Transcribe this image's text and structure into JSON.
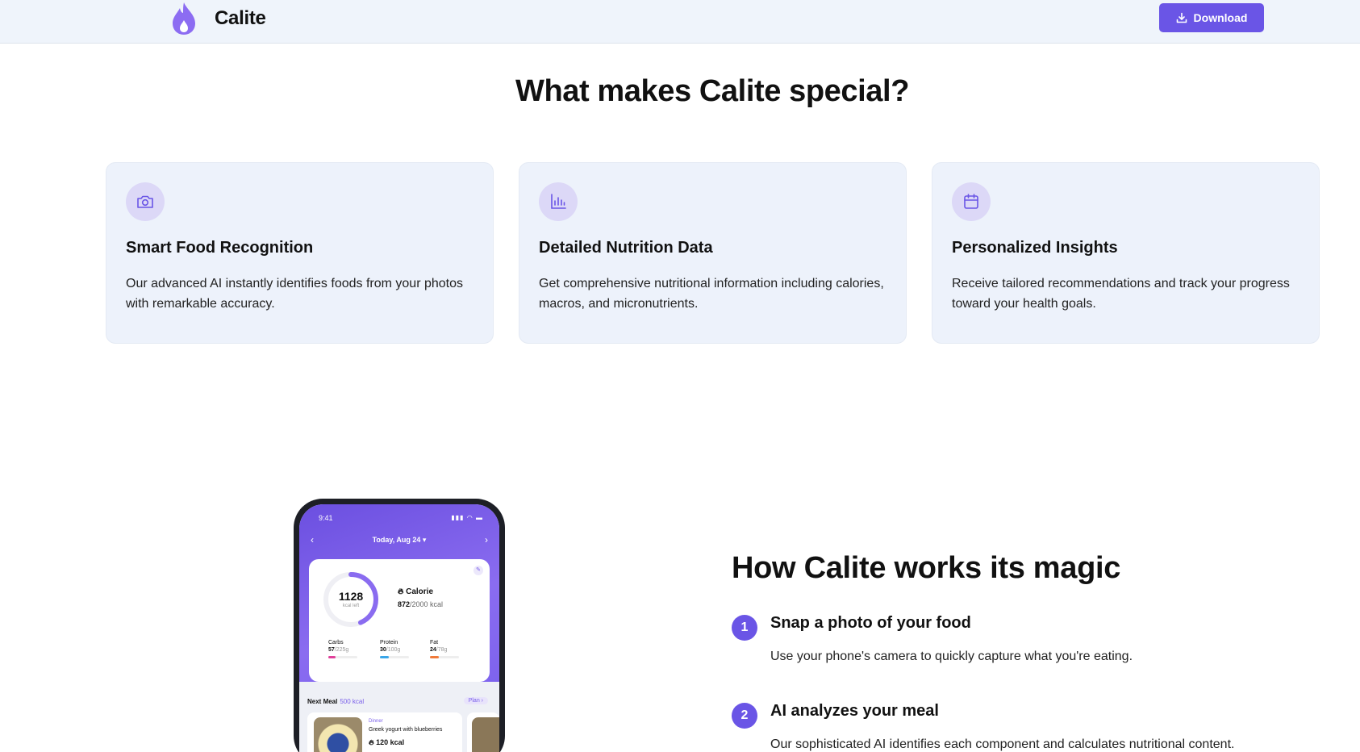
{
  "header": {
    "brand": "Calite",
    "download_label": "Download"
  },
  "features": {
    "heading": "What makes Calite special?",
    "cards": [
      {
        "icon": "camera-icon",
        "title": "Smart Food Recognition",
        "desc": "Our advanced AI instantly identifies foods from your photos with remarkable accuracy."
      },
      {
        "icon": "bar-chart-icon",
        "title": "Detailed Nutrition Data",
        "desc": "Get comprehensive nutritional information including calories, macros, and micronutrients."
      },
      {
        "icon": "calendar-icon",
        "title": "Personalized Insights",
        "desc": "Receive tailored recommendations and track your progress toward your health goals."
      }
    ]
  },
  "phone": {
    "time": "9:41",
    "date": "Today, Aug 24 ▾",
    "kcal_left": "1128",
    "kcal_left_label": "kcal left",
    "calorie_title": "Calorie",
    "calorie_eaten": "872",
    "calorie_goal": "/2000 kcal",
    "calorie_progress": 0.436,
    "macros": [
      {
        "name": "Carbs",
        "value": "57",
        "goal": "/225g",
        "color": "#e0409a",
        "progress": 0.25
      },
      {
        "name": "Protein",
        "value": "30",
        "goal": "/100g",
        "color": "#3aa6e8",
        "progress": 0.3
      },
      {
        "name": "Fat",
        "value": "24",
        "goal": "/78g",
        "color": "#f07a3a",
        "progress": 0.31
      }
    ],
    "next_meal_label": "Next Meal",
    "next_meal_kcal": "500 kcal",
    "plan_label": "Plan ›",
    "meal": {
      "type": "Dinner",
      "name": "Greek yogurt with blueberries",
      "kcal": "120 kcal"
    }
  },
  "how": {
    "heading": "How Calite works its magic",
    "steps": [
      {
        "num": "1",
        "title": "Snap a photo of your food",
        "desc": "Use your phone's camera to quickly capture what you're eating."
      },
      {
        "num": "2",
        "title": "AI analyzes your meal",
        "desc": "Our sophisticated AI identifies each component and calculates nutritional content."
      }
    ]
  },
  "colors": {
    "accent": "#6a55e6",
    "card_bg": "#edf2fb",
    "header_bg": "#eff4fb",
    "icon_bg": "#dcd8f7"
  }
}
